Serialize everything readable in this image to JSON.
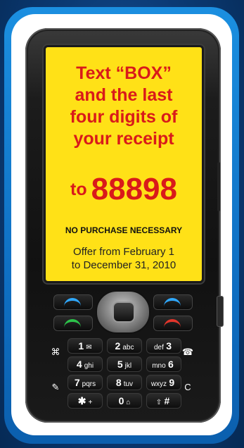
{
  "headline": [
    "Text “BOX”",
    "and the last",
    "four digits of",
    "your receipt"
  ],
  "code": {
    "prefix": "to",
    "number": "88898"
  },
  "disclaimer": "NO PURCHASE NECESSARY",
  "offer": [
    "Offer from February 1",
    "to December 31, 2010"
  ],
  "colors": {
    "accent": "#d91a1a",
    "screen": "#ffe117",
    "frame": "#1b8fe0"
  },
  "keypad": {
    "rows": [
      [
        {
          "num": "1",
          "letters": "✉"
        },
        {
          "num": "2",
          "letters": "abc"
        },
        {
          "num": "3",
          "letters": "def"
        }
      ],
      [
        {
          "num": "4",
          "letters": "ghi"
        },
        {
          "num": "5",
          "letters": "jkl"
        },
        {
          "num": "6",
          "letters": "mno"
        }
      ],
      [
        {
          "num": "7",
          "letters": "pqrs"
        },
        {
          "num": "8",
          "letters": "tuv"
        },
        {
          "num": "9",
          "letters": "wxyz"
        }
      ],
      [
        {
          "num": "✱",
          "letters": "+"
        },
        {
          "num": "0",
          "letters": "⌂"
        },
        {
          "num": "#",
          "letters": "⇧"
        }
      ]
    ],
    "left_icons": [
      "⌘",
      "✎"
    ],
    "right_icons": [
      "☎",
      "C"
    ]
  }
}
